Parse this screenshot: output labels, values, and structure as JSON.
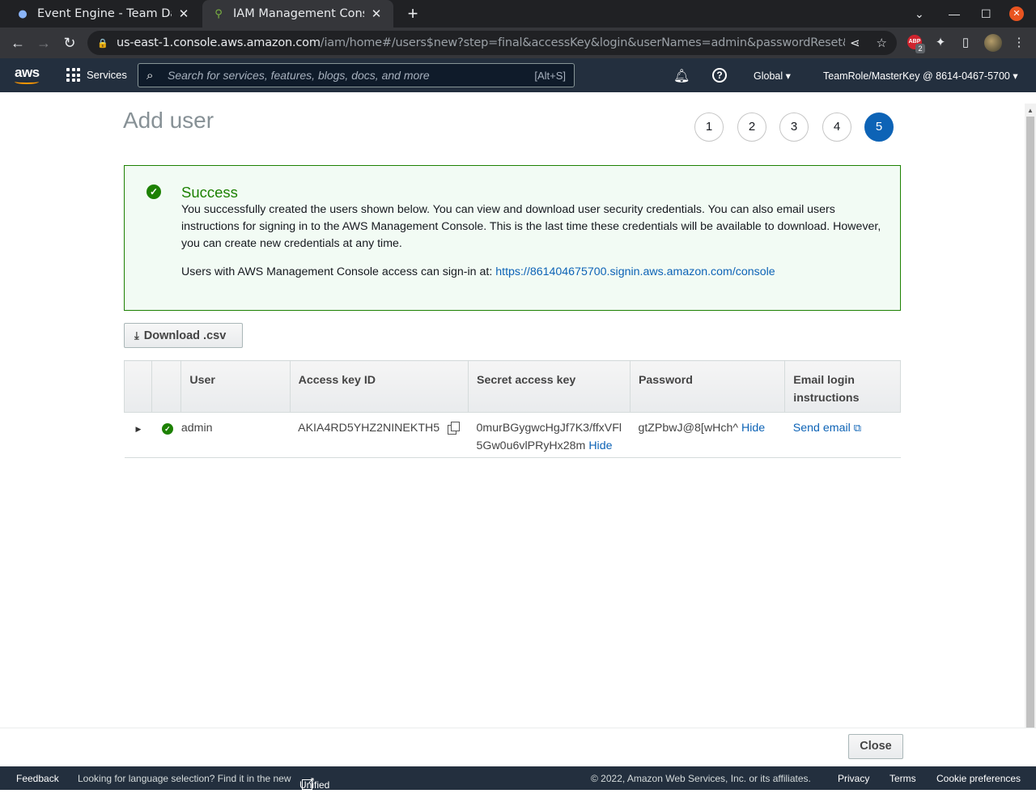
{
  "browser": {
    "tabs": [
      {
        "title": "Event Engine - Team Dash",
        "active": false
      },
      {
        "title": "IAM Management Console",
        "active": true
      }
    ],
    "url_host": "us-east-1.console.aws.amazon.com",
    "url_path": "/iam/home#/users$new?step=final&accessKey&login&userNames=admin&passwordReset&passwordType...",
    "extension_badge": "2"
  },
  "aws_nav": {
    "logo_text": "aws",
    "services_label": "Services",
    "search_placeholder": "Search for services, features, blogs, docs, and more",
    "search_shortcut": "[Alt+S]",
    "region": "Global",
    "account": "TeamRole/MasterKey @ 8614-0467-5700"
  },
  "page": {
    "title": "Add user",
    "steps": [
      "1",
      "2",
      "3",
      "4",
      "5"
    ],
    "current_step": 5
  },
  "success": {
    "heading": "Success",
    "message": "You successfully created the users shown below. You can view and download user security credentials. You can also email users instructions for signing in to the AWS Management Console. This is the last time these credentials will be available to download. However, you can create new credentials at any time.",
    "signin_prefix": "Users with AWS Management Console access can sign-in at: ",
    "signin_url": "https://861404675700.signin.aws.amazon.com/console"
  },
  "download_button": "Download .csv",
  "table": {
    "headers": {
      "user": "User",
      "access_key": "Access key ID",
      "secret": "Secret access key",
      "password": "Password",
      "email_line1": "Email login",
      "email_line2": "instructions"
    },
    "rows": [
      {
        "user": "admin",
        "access_key": "AKIA4RD5YHZ2NINEKTH5",
        "secret_line1": "0murBGygwcHgJf7K3/ffxVFl",
        "secret_line2": "5Gw0u6vlPRyHx28m",
        "secret_hide": "Hide",
        "password": "gtZPbwJ@8[wHch^",
        "password_hide": "Hide",
        "email": "Send email"
      }
    ]
  },
  "close_button": "Close",
  "footer": {
    "feedback": "Feedback",
    "lang_prefix": "Looking for language selection? Find it in the new",
    "lang_link": "Unified Settings",
    "copyright": "© 2022, Amazon Web Services, Inc. or its affiliates.",
    "privacy": "Privacy",
    "terms": "Terms",
    "cookies": "Cookie preferences"
  },
  "colors": {
    "aws_nav": "#232f3e",
    "success": "#1d8102",
    "link": "#0d63b6",
    "aws_orange": "#ff9900"
  }
}
